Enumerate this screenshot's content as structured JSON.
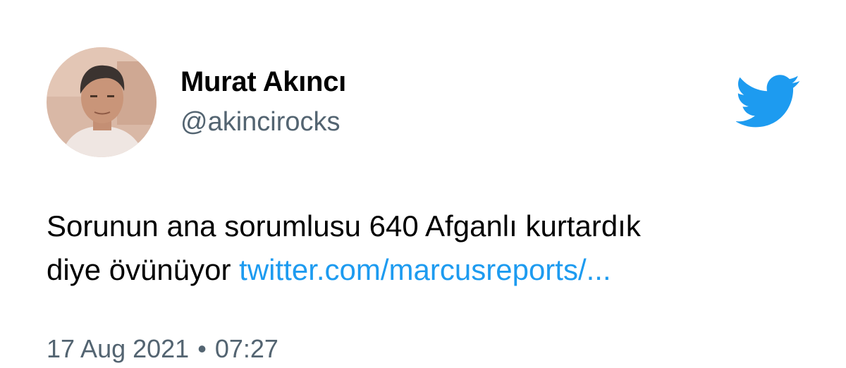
{
  "author": {
    "name": "Murat Akıncı",
    "handle": "@akincirocks"
  },
  "tweet": {
    "text_line1": "Sorunun ana sorumlusu 640 Afganlı kurtardık",
    "text_line2": "diye övünüyor",
    "link": "twitter.com/marcusreports/..."
  },
  "meta": {
    "date": "17 Aug 2021",
    "separator": "•",
    "time": "07:27"
  },
  "icons": {
    "brand": "twitter-bird-icon",
    "avatar": "profile-photo"
  },
  "colors": {
    "link": "#1d9bf0",
    "secondary_text": "#536471",
    "brand": "#1d9bf0"
  }
}
